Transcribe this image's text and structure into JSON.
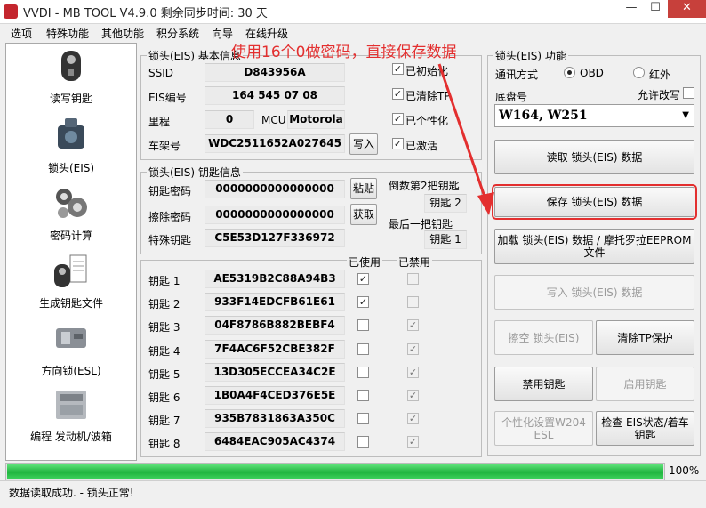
{
  "window": {
    "title": "VVDI - MB TOOL V4.9.0    剩余同步时间: 30 天",
    "min_label": "—",
    "max_label": "☐",
    "close_label": "✕"
  },
  "menu": [
    "选项",
    "特殊功能",
    "其他功能",
    "积分系统",
    "向导",
    "在线升级"
  ],
  "annotation": "使用16个0做密码，直接保存数据",
  "sidebar": [
    {
      "label": "读写钥匙",
      "icon": "key-icon"
    },
    {
      "label": "锁头(EIS)",
      "icon": "eis-icon"
    },
    {
      "label": "密码计算",
      "icon": "calculator-icon"
    },
    {
      "label": "生成钥匙文件",
      "icon": "key-file-icon"
    },
    {
      "label": "方向锁(ESL)",
      "icon": "esl-icon"
    },
    {
      "label": "编程 发动机/波箱",
      "icon": "ecu-icon"
    }
  ],
  "eis_basic": {
    "title": "锁头(EIS) 基本信息",
    "ssid_label": "SSID",
    "ssid": "D843956A",
    "eis_no_label": "EIS编号",
    "eis_no": "164 545 07 08",
    "mileage_label": "里程",
    "mileage": "0",
    "mcu_label": "MCU",
    "mcu": "Motorola",
    "vin_label": "车架号",
    "vin": "WDC2511652A027645",
    "write_button": "写入",
    "checks": [
      {
        "label": "已初始化",
        "checked": true
      },
      {
        "label": "已清除TP",
        "checked": true
      },
      {
        "label": "已个性化",
        "checked": true
      },
      {
        "label": "已激活",
        "checked": true
      }
    ]
  },
  "key_info": {
    "title": "锁头(EIS) 钥匙信息",
    "key_password_label": "钥匙密码",
    "key_password": "0000000000000000",
    "paste_button": "粘贴",
    "erase_password_label": "擦除密码",
    "erase_password": "0000000000000000",
    "get_button": "获取",
    "special_key_label": "特殊钥匙",
    "special_key": "C5E53D127F336972",
    "second_last_label": "倒数第2把钥匙",
    "second_last": "钥匙 2",
    "last_label": "最后一把钥匙",
    "last": "钥匙 1"
  },
  "keys_table": {
    "used_header": "已使用",
    "disabled_header": "已禁用",
    "rows": [
      {
        "label": "钥匙 1",
        "value": "AE5319B2C88A94B3",
        "used": true,
        "disabled": false
      },
      {
        "label": "钥匙 2",
        "value": "933F14EDCFB61E61",
        "used": true,
        "disabled": false
      },
      {
        "label": "钥匙 3",
        "value": "04F8786B882BEBF4",
        "used": false,
        "disabled": true
      },
      {
        "label": "钥匙 4",
        "value": "7F4AC6F52CBE382F",
        "used": false,
        "disabled": true
      },
      {
        "label": "钥匙 5",
        "value": "13D305ECCEA34C2E",
        "used": false,
        "disabled": true
      },
      {
        "label": "钥匙 6",
        "value": "1B0A4F4CED376E5E",
        "used": false,
        "disabled": true
      },
      {
        "label": "钥匙 7",
        "value": "935B7831863A350C",
        "used": false,
        "disabled": true
      },
      {
        "label": "钥匙 8",
        "value": "6484EAC905AC4374",
        "used": false,
        "disabled": true
      }
    ]
  },
  "eis_function": {
    "title": "锁头(EIS) 功能",
    "comm_label": "通讯方式",
    "obd_label": "OBD",
    "ir_label": "红外",
    "chassis_label": "底盘号",
    "allow_rewrite_label": "允许改写",
    "chassis_value": "W164, W251",
    "buttons": {
      "read": "读取 锁头(EIS) 数据",
      "save": "保存 锁头(EIS) 数据",
      "load": "加载 锁头(EIS) 数据 / 摩托罗拉EEPROM 文件",
      "write": "写入 锁头(EIS) 数据",
      "erase": "擦空 锁头(EIS)",
      "clear_tp": "清除TP保护",
      "disable_key": "禁用钥匙",
      "enable_key": "启用钥匙",
      "personalize": "个性化设置W204 ESL",
      "check": "检查 EIS状态/着车钥匙"
    }
  },
  "progress": {
    "value": 1.0,
    "label": "100%"
  },
  "status": "数据读取成功. - 锁头正常!",
  "colors": {
    "annotation": "#e32f2f",
    "progress": "#2fc24b"
  }
}
